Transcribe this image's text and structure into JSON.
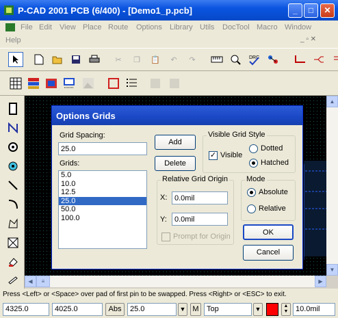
{
  "window": {
    "title": "P-CAD 2001 PCB (6/400) - [Demo1_p.pcb]",
    "min": "_",
    "max": "□",
    "close": "✕"
  },
  "menu": [
    "File",
    "Edit",
    "View",
    "Place",
    "Route",
    "Options",
    "Library",
    "Utils",
    "DocTool",
    "Macro",
    "Window",
    "Help"
  ],
  "dialog": {
    "title": "Options Grids",
    "grid_spacing_label": "Grid Spacing:",
    "grid_spacing_value": "25.0",
    "grids_label": "Grids:",
    "grids": [
      "5.0",
      "10.0",
      "12.5",
      "25.0",
      "50.0",
      "100.0"
    ],
    "selected_grid": "25.0",
    "add": "Add",
    "delete": "Delete",
    "visible_style": {
      "label": "Visible Grid Style",
      "visible": "Visible",
      "dotted": "Dotted",
      "hatched": "Hatched"
    },
    "relative_origin": {
      "label": "Relative Grid Origin",
      "x_label": "X:",
      "x_value": "0.0mil",
      "y_label": "Y:",
      "y_value": "0.0mil",
      "prompt": "Prompt for Origin"
    },
    "mode": {
      "label": "Mode",
      "absolute": "Absolute",
      "relative": "Relative"
    },
    "ok": "OK",
    "cancel": "Cancel"
  },
  "status_line": "Press <Left> or <Space> over pad of first pin to be swapped. Press <Right> or <ESC> to exit.",
  "statusbar": {
    "x": "4325.0",
    "y": "4025.0",
    "abs": "Abs",
    "grid": "25.0",
    "m": "M",
    "layer": "Top",
    "width": "10.0mil"
  },
  "colors": {
    "accent": "#0a54e0",
    "layer_color": "#ff0000",
    "selection": "#316ac5"
  }
}
